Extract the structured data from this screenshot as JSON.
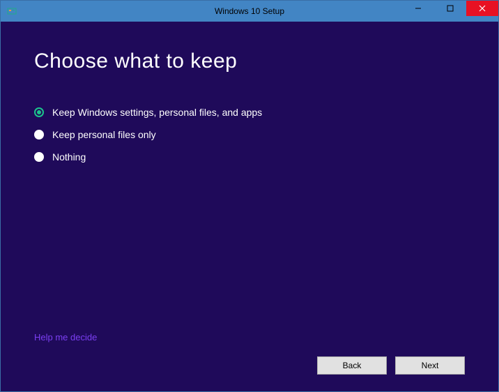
{
  "window": {
    "title": "Windows 10 Setup"
  },
  "heading": "Choose what to keep",
  "options": [
    {
      "label": "Keep Windows settings, personal files, and apps",
      "selected": true
    },
    {
      "label": "Keep personal files only",
      "selected": false
    },
    {
      "label": "Nothing",
      "selected": false
    }
  ],
  "help_link": "Help me decide",
  "buttons": {
    "back": "Back",
    "next": "Next"
  }
}
